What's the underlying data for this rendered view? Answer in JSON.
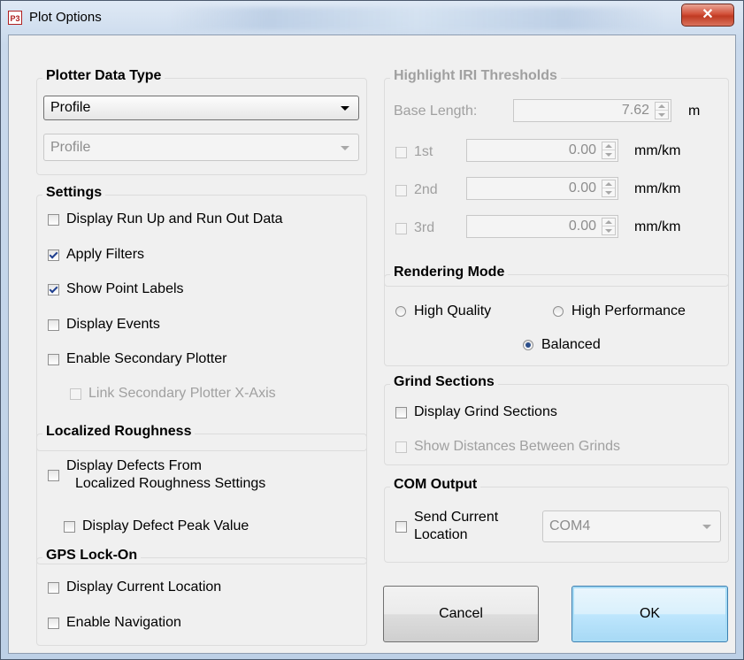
{
  "window": {
    "title": "Plot Options",
    "app_icon_text": "P3",
    "close_symbol": "✕"
  },
  "plotter_data_type": {
    "title": "Plotter Data Type",
    "primary_value": "Profile",
    "secondary_value": "Profile"
  },
  "settings": {
    "title": "Settings",
    "items": [
      {
        "label": "Display Run Up and Run Out Data",
        "checked": false,
        "enabled": true
      },
      {
        "label": "Apply Filters",
        "checked": true,
        "enabled": true
      },
      {
        "label": "Show Point Labels",
        "checked": true,
        "enabled": true
      },
      {
        "label": "Display Events",
        "checked": false,
        "enabled": true
      },
      {
        "label": "Enable Secondary Plotter",
        "checked": false,
        "enabled": true
      },
      {
        "label": "Link Secondary Plotter X-Axis",
        "checked": false,
        "enabled": false
      }
    ]
  },
  "localized_roughness": {
    "title": "Localized Roughness",
    "defects_label_line1": "Display Defects From",
    "defects_label_line2": "Localized Roughness Settings",
    "peak_label": "Display Defect Peak Value"
  },
  "gps_lock_on": {
    "title": "GPS Lock-On",
    "current_location_label": "Display Current Location",
    "navigation_label": "Enable Navigation"
  },
  "iri_thresholds": {
    "title": "Highlight IRI Thresholds",
    "base_length_label": "Base Length:",
    "base_length_value": "7.62",
    "base_length_unit": "m",
    "thresholds": [
      {
        "label": "1st",
        "value": "0.00",
        "unit": "mm/km"
      },
      {
        "label": "2nd",
        "value": "0.00",
        "unit": "mm/km"
      },
      {
        "label": "3rd",
        "value": "0.00",
        "unit": "mm/km"
      }
    ]
  },
  "rendering_mode": {
    "title": "Rendering Mode",
    "high_quality": "High Quality",
    "high_performance": "High Performance",
    "balanced": "Balanced",
    "selected": "Balanced"
  },
  "grind_sections": {
    "title": "Grind Sections",
    "display_label": "Display Grind Sections",
    "distances_label": "Show Distances Between Grinds"
  },
  "com_output": {
    "title": "COM Output",
    "send_label_line1": "Send Current",
    "send_label_line2": "Location",
    "port_value": "COM4"
  },
  "buttons": {
    "cancel": "Cancel",
    "ok": "OK"
  }
}
